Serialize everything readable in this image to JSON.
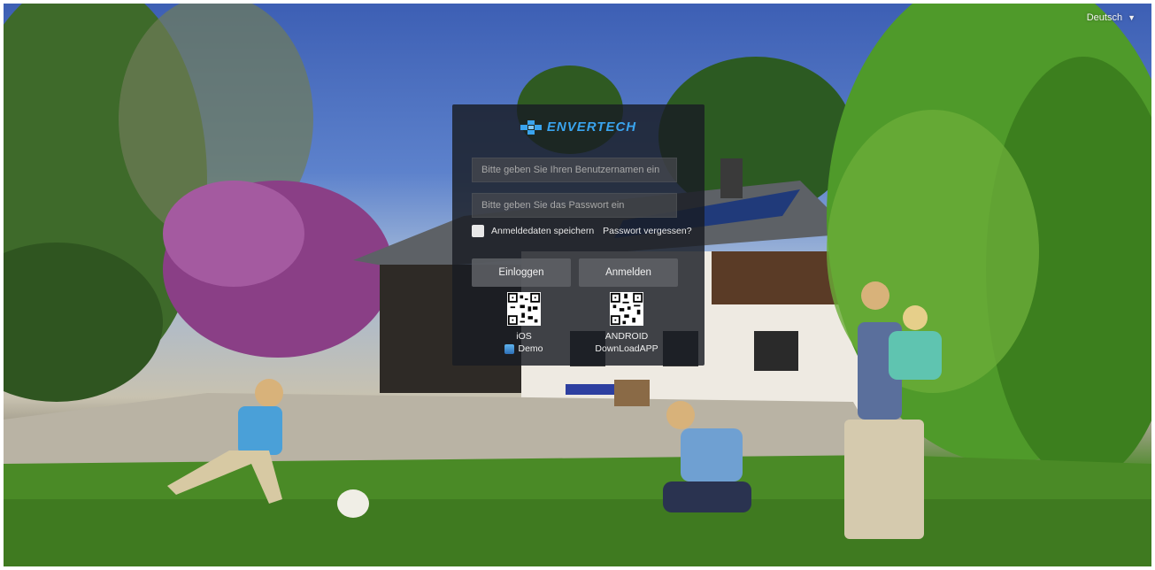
{
  "language": {
    "label": "Deutsch"
  },
  "brand": {
    "name": "ENVERTECH",
    "color": "#3aa4ee"
  },
  "login": {
    "username_placeholder": "Bitte geben Sie Ihren Benutzernamen ein",
    "password_placeholder": "Bitte geben Sie das Passwort ein",
    "remember_label": "Anmeldedaten speichern",
    "forgot_label": "Passwort vergessen?",
    "login_button": "Einloggen",
    "register_button": "Anmelden"
  },
  "apps": {
    "ios": {
      "label": "iOS",
      "sub_label": "Demo"
    },
    "android": {
      "label": "ANDROID",
      "sub_label": "DownLoadAPP"
    }
  },
  "background": {
    "description_icon": "family-house-garden-photo"
  }
}
